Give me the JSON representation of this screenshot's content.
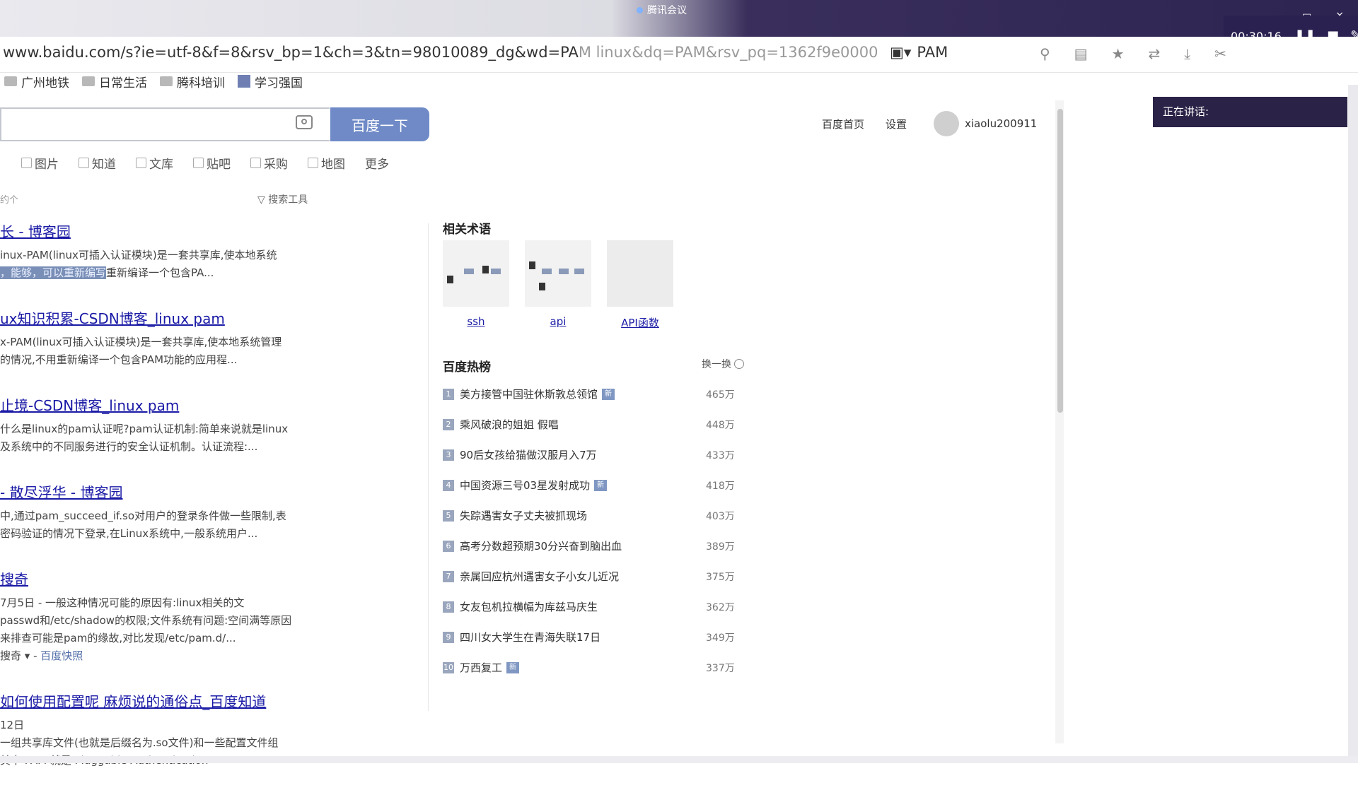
{
  "meeting": {
    "title": "腾讯会议",
    "timer": "00:30:16",
    "speaking_label": "正在讲话:"
  },
  "browser": {
    "url_main": "www.baidu.com/s?ie=utf-8&f=8&rsv_bp=1&ch=3&tn=98010089_dg&wd=PA",
    "url_dim": "M linux&dq=PAM&rsv_pq=1362f9e0000",
    "address_search": "PAM",
    "bookmarks": [
      "广州地铁",
      "日常生活",
      "腾科培训",
      "学习强国"
    ]
  },
  "baidu": {
    "search_button": "百度一下",
    "top_links": [
      "百度首页",
      "设置"
    ],
    "username": "xiaolu200911",
    "tabs": [
      "图片",
      "知道",
      "文库",
      "贴吧",
      "采购",
      "地图",
      "更多"
    ],
    "result_count": "约个",
    "search_tools": "搜索工具"
  },
  "results": [
    {
      "title": "长 - 博客园",
      "lines": [
        "inux-PAM(linux可插入认证模块)是一套共享库,使本地系统",
        "..."
      ],
      "line2_highlight": "，能够，可以重新编写",
      "line2_rest": "重新编译一个包含PA..."
    },
    {
      "title": "ux知识积累-CSDN博客_linux pam",
      "lines": [
        "x-PAM(linux可插入认证模块)是一套共享库,使本地系统管理",
        "  的情况,不用重新编译一个包含PAM功能的应用程..."
      ]
    },
    {
      "title": "止境-CSDN博客_linux pam",
      "lines": [
        "什么是linux的pam认证呢?pam认证机制:简单来说就是linux",
        "及系统中的不同服务进行的安全认证机制。认证流程:..."
      ]
    },
    {
      "title": "- 散尽浮华 - 博客园",
      "lines": [
        "中,通过pam_succeed_if.so对用户的登录条件做一些限制,表",
        "密码验证的情况下登录,在Linux系统中,一般系统用户..."
      ]
    },
    {
      "title": "搜奇",
      "lines": [
        "7月5日 - 一般这种情况可能的原因有:linux相关的文",
        "passwd和/etc/shadow的权限;文件系统有问题:空间满等原因",
        "来排查可能是pam的缘故,对比发现/etc/pam.d/..."
      ],
      "source": "搜奇",
      "cache": "百度快照"
    },
    {
      "title": "如何使用配置呢 麻烦说的通俗点_百度知道",
      "lines": [
        "12日",
        "一组共享库文件(也就是后缀名为.so文件)和一些配置文件组",
        "其中 PAM 就是 Pluggable Authentication"
      ]
    }
  ],
  "related": {
    "title": "相关术语",
    "items": [
      "ssh",
      "api",
      "API函数"
    ]
  },
  "hot": {
    "title": "百度热榜",
    "refresh": "换一换",
    "new_badge": "新",
    "items": [
      {
        "rank": "1",
        "text": "美方接管中国驻休斯敦总领馆",
        "heat": "465万",
        "new": true
      },
      {
        "rank": "2",
        "text": "乘风破浪的姐姐 假唱",
        "heat": "448万",
        "new": false
      },
      {
        "rank": "3",
        "text": "90后女孩给猫做汉服月入7万",
        "heat": "433万",
        "new": false
      },
      {
        "rank": "4",
        "text": "中国资源三号03星发射成功",
        "heat": "418万",
        "new": true
      },
      {
        "rank": "5",
        "text": "失踪遇害女子丈夫被抓现场",
        "heat": "403万",
        "new": false
      },
      {
        "rank": "6",
        "text": "高考分数超预期30分兴奋到脑出血",
        "heat": "389万",
        "new": false
      },
      {
        "rank": "7",
        "text": "亲属回应杭州遇害女子小女儿近况",
        "heat": "375万",
        "new": false
      },
      {
        "rank": "8",
        "text": "女友包机拉横幅为库兹马庆生",
        "heat": "362万",
        "new": false
      },
      {
        "rank": "9",
        "text": "四川女大学生在青海失联17日",
        "heat": "349万",
        "new": false
      },
      {
        "rank": "10",
        "text": "万西复工",
        "heat": "337万",
        "new": true
      }
    ]
  }
}
